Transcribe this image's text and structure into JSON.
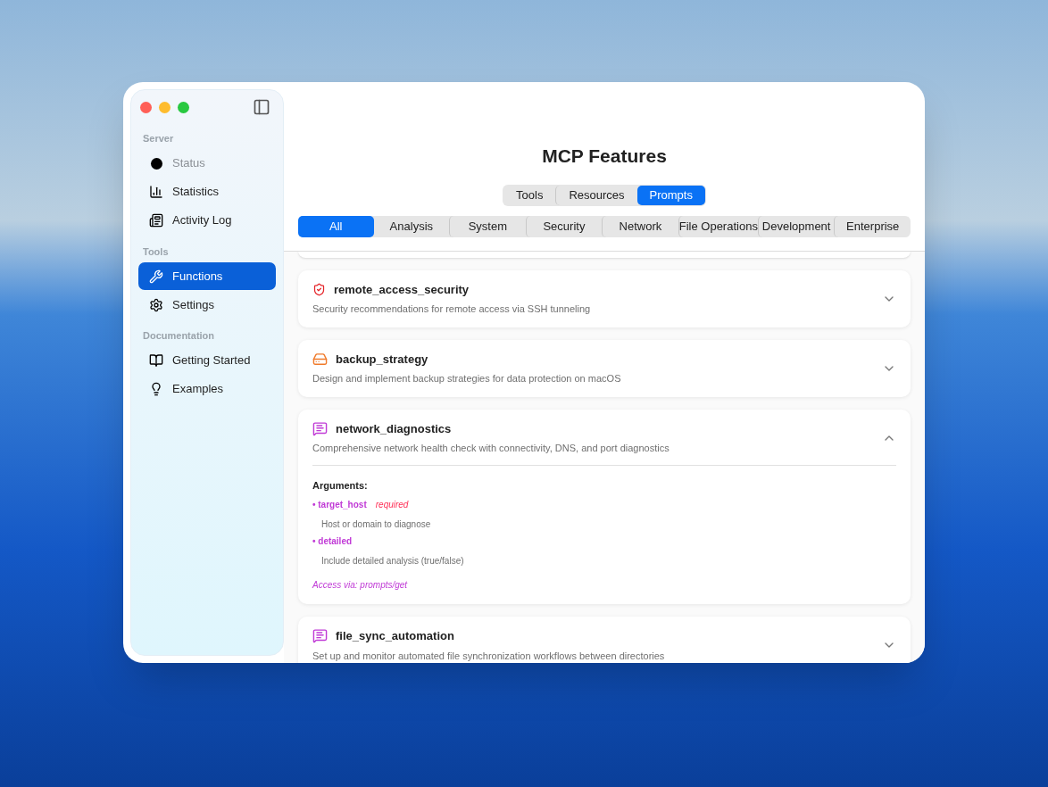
{
  "sidebar": {
    "sections": [
      {
        "title": "Server",
        "items": [
          {
            "label": "Status",
            "kind": "dot",
            "selected": false,
            "disabled": true
          },
          {
            "label": "Statistics",
            "kind": "chart",
            "selected": false,
            "disabled": false
          },
          {
            "label": "Activity Log",
            "kind": "log",
            "selected": false,
            "disabled": false
          }
        ]
      },
      {
        "title": "Tools",
        "items": [
          {
            "label": "Functions",
            "kind": "tools",
            "selected": true,
            "disabled": false
          },
          {
            "label": "Settings",
            "kind": "gear",
            "selected": false,
            "disabled": false
          }
        ]
      },
      {
        "title": "Documentation",
        "items": [
          {
            "label": "Getting Started",
            "kind": "book",
            "selected": false,
            "disabled": false
          },
          {
            "label": "Examples",
            "kind": "bulb",
            "selected": false,
            "disabled": false
          }
        ]
      }
    ]
  },
  "title": "MCP Features",
  "tabs": [
    {
      "label": "Tools",
      "selected": false
    },
    {
      "label": "Resources",
      "selected": false
    },
    {
      "label": "Prompts",
      "selected": true
    }
  ],
  "filters": [
    {
      "label": "All",
      "selected": true
    },
    {
      "label": "Analysis",
      "selected": false
    },
    {
      "label": "System",
      "selected": false
    },
    {
      "label": "Security",
      "selected": false
    },
    {
      "label": "Network",
      "selected": false
    },
    {
      "label": "File Operations",
      "selected": false
    },
    {
      "label": "Development",
      "selected": false
    },
    {
      "label": "Enterprise",
      "selected": false
    }
  ],
  "cards": [
    {
      "kind": "shield",
      "name": "remote_access_security",
      "description": "Security recommendations for remote access via SSH tunneling",
      "expanded": false
    },
    {
      "kind": "drive",
      "name": "backup_strategy",
      "description": "Design and implement backup strategies for data protection on macOS",
      "expanded": false
    },
    {
      "kind": "chat",
      "name": "network_diagnostics",
      "description": "Comprehensive network health check with connectivity, DNS, and port diagnostics",
      "expanded": true,
      "arguments_title": "Arguments:",
      "arguments": [
        {
          "name": "• target_host",
          "required": true,
          "required_label": "required",
          "description": "Host or domain to diagnose"
        },
        {
          "name": "• detailed",
          "required": false,
          "description": "Include detailed analysis (true/false)"
        }
      ],
      "access": "Access via: prompts/get"
    },
    {
      "kind": "chat",
      "name": "file_sync_automation",
      "description": "Set up and monitor automated file synchronization workflows between directories",
      "expanded": false
    }
  ]
}
